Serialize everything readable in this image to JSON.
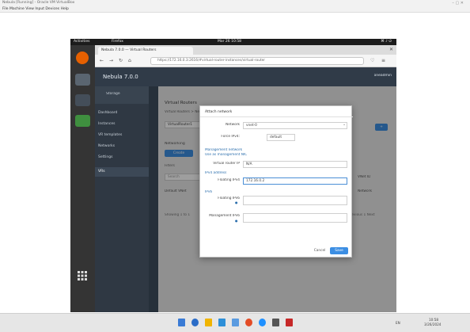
{
  "vnc": {
    "title": "Nebula [Running] - Oracle VM VirtualBox",
    "menu": "File Machine View Input Devices Help",
    "controls": "–  ▢  ✕"
  },
  "gnome": {
    "activities": "Activities",
    "app": "Firefox",
    "clock": "Mar 26 10:58",
    "status": "⌘ ♪ ⏻"
  },
  "browser": {
    "tab_label": "Nebula 7.0.0 — Virtual Routers",
    "url": "https://172.16.0.3:2616/#virtual-router-instances/virtual-router"
  },
  "app": {
    "title": "Nebula 7.0.0",
    "user": "oneadmin",
    "side_header": "Storage",
    "sidebar": [
      "Dashboard",
      "Instances",
      "VR templates",
      "Networks",
      "Settings",
      "VRs"
    ],
    "content_heading": "Virtual Routers",
    "breadcrumb": "Virtual Routers > New",
    "name_value": "VirtualRouter1",
    "section_label": "Networking",
    "create_button": "Create",
    "filter_label": "Filters",
    "table_header": "Search",
    "table_header2": "Network",
    "row_text": "Default VNet",
    "bottom_text": "Showing 1 to 1",
    "right_tag": "VNet ID",
    "page_label": "Previous 1 Next"
  },
  "dialog": {
    "title": "Attach network",
    "network_label": "Network",
    "network_value": "vnet-0",
    "force_ipv4_label": "Force IPv4:",
    "force_ipv4_value": "default",
    "management_heading": "Management network",
    "management_sub": "Use as management NIC",
    "virtual_ip_label": "Virtual router IP",
    "virtual_ip_value": "N/A",
    "ipv4_heading": "IPv4 address",
    "floating_label": "Floating IPv4",
    "floating_value": "172.16.0.2",
    "ipv6_heading": "IPv6",
    "ipv6_label": "Floating IPv6",
    "mgmt_ipv6_label": "Management IPv6",
    "cancel": "Cancel",
    "save": "Save"
  },
  "tray": {
    "lang": "EN",
    "time": "10:58",
    "date": "3/26/2024"
  }
}
